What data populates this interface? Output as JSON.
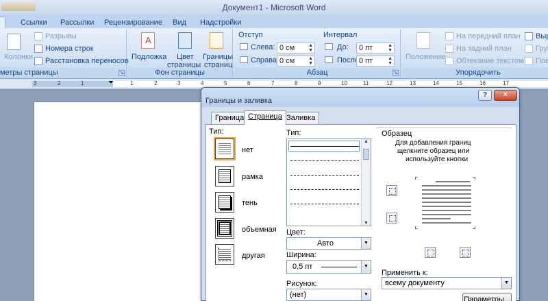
{
  "window": {
    "title": "Документ1 - Microsoft Word"
  },
  "tabs": [
    {
      "label": "Ссылки"
    },
    {
      "label": "Рассылки"
    },
    {
      "label": "Рецензирование"
    },
    {
      "label": "Вид"
    },
    {
      "label": "Надстройки"
    }
  ],
  "ribbon": {
    "page_setup": {
      "columns_label": "Колонки",
      "breaks_label": "Разрывы",
      "line_numbers_label": "Номера строк",
      "hyphenation_label": "Расстановка переносов",
      "group_label": "метры страницы"
    },
    "page_background": {
      "watermark_label": "Подложка",
      "page_color_label_1": "Цвет",
      "page_color_label_2": "страницы",
      "page_borders_label_1": "Границы",
      "page_borders_label_2": "страниц",
      "group_label": "Фон страницы"
    },
    "paragraph": {
      "indent_header": "Отступ",
      "left_label": "Слева:",
      "left_value": "0 см",
      "right_label": "Справа:",
      "right_value": "0 см",
      "spacing_header": "Интервал",
      "before_label": "До:",
      "before_value": "0 пт",
      "after_label": "После:",
      "after_value": "0 пт",
      "group_label": "Абзац"
    },
    "arrange": {
      "position_label": "Положение",
      "bring_front_label": "На передний план",
      "send_back_label": "На задний план",
      "wrap_label": "Обтекание текстом",
      "align_label": "Выр",
      "group_label_short": "Груп",
      "rotate_label_short": "Пов",
      "group_label": "Упорядочить"
    }
  },
  "ruler": {
    "ticks": [
      "3",
      "2",
      "1",
      "1",
      "2",
      "3",
      "4",
      "5",
      "6",
      "7",
      "8",
      "9",
      "10",
      "11",
      "12",
      "13",
      "14",
      "15",
      "16",
      "17"
    ]
  },
  "dialog": {
    "title": "Границы и заливка",
    "help": "?",
    "close": "✕",
    "tabs": {
      "borders": "Граница",
      "page": "Страница",
      "shading": "Заливка"
    },
    "type_label": "Тип:",
    "types": [
      {
        "label": "нет"
      },
      {
        "label": "рамка"
      },
      {
        "label": "тень"
      },
      {
        "label": "объемная"
      },
      {
        "label": "другая"
      }
    ],
    "style_label": "Тип:",
    "color_label": "Цвет:",
    "color_value": "Авто",
    "width_label": "Ширина:",
    "width_value": "0,5 пт",
    "art_label": "Рисунок:",
    "art_value": "(нет)",
    "preview_label": "Образец",
    "preview_hint_1": "Для добавления границ",
    "preview_hint_2": "щелкните образец или",
    "preview_hint_3": "используйте кнопки",
    "apply_label": "Применить к:",
    "apply_value": "всему документу",
    "options_button": "Параметры..."
  }
}
